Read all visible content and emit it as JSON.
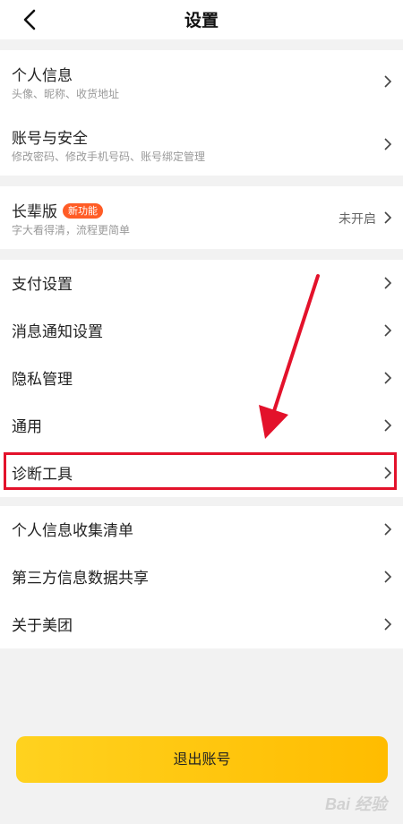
{
  "header": {
    "title": "设置"
  },
  "groups": {
    "account": [
      {
        "title": "个人信息",
        "subtitle": "头像、昵称、收货地址"
      },
      {
        "title": "账号与安全",
        "subtitle": "修改密码、修改手机号码、账号绑定管理"
      }
    ],
    "elder": {
      "title": "长辈版",
      "badge": "新功能",
      "subtitle": "字大看得清，流程更简单",
      "status": "未开启"
    },
    "settings": [
      {
        "label": "支付设置"
      },
      {
        "label": "消息通知设置"
      },
      {
        "label": "隐私管理"
      },
      {
        "label": "通用"
      },
      {
        "label": "诊断工具"
      }
    ],
    "about": [
      {
        "label": "个人信息收集清单"
      },
      {
        "label": "第三方信息数据共享"
      },
      {
        "label": "关于美团"
      }
    ]
  },
  "logout_label": "退出账号",
  "watermark": "Bai 经验",
  "colors": {
    "accent": "#ffc107",
    "annotation": "#e3122b",
    "badge": "#ff5c26"
  }
}
